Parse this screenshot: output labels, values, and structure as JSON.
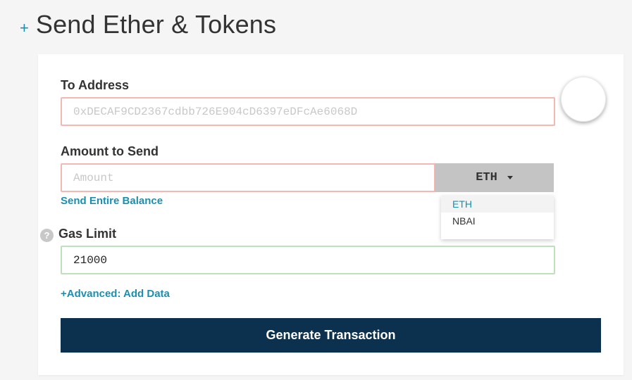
{
  "header": {
    "plus": "+",
    "title": "Send Ether & Tokens"
  },
  "to_address": {
    "label": "To Address",
    "placeholder": "0xDECAF9CD2367cdbb726E904cD6397eDFcAe6068D"
  },
  "amount": {
    "label": "Amount to Send",
    "placeholder": "Amount",
    "unit": "ETH",
    "unit_options": [
      "ETH",
      "NBAI"
    ],
    "send_entire_balance": "Send Entire Balance"
  },
  "gas_limit": {
    "help": "?",
    "label": "Gas Limit",
    "value": "21000"
  },
  "advanced_link": "+Advanced: Add Data",
  "generate_button": "Generate Transaction",
  "colors": {
    "accent": "#1a8fb0",
    "primary_button": "#0c314f",
    "invalid_border": "#f3b8b3",
    "valid_border": "#bfe0bd"
  }
}
